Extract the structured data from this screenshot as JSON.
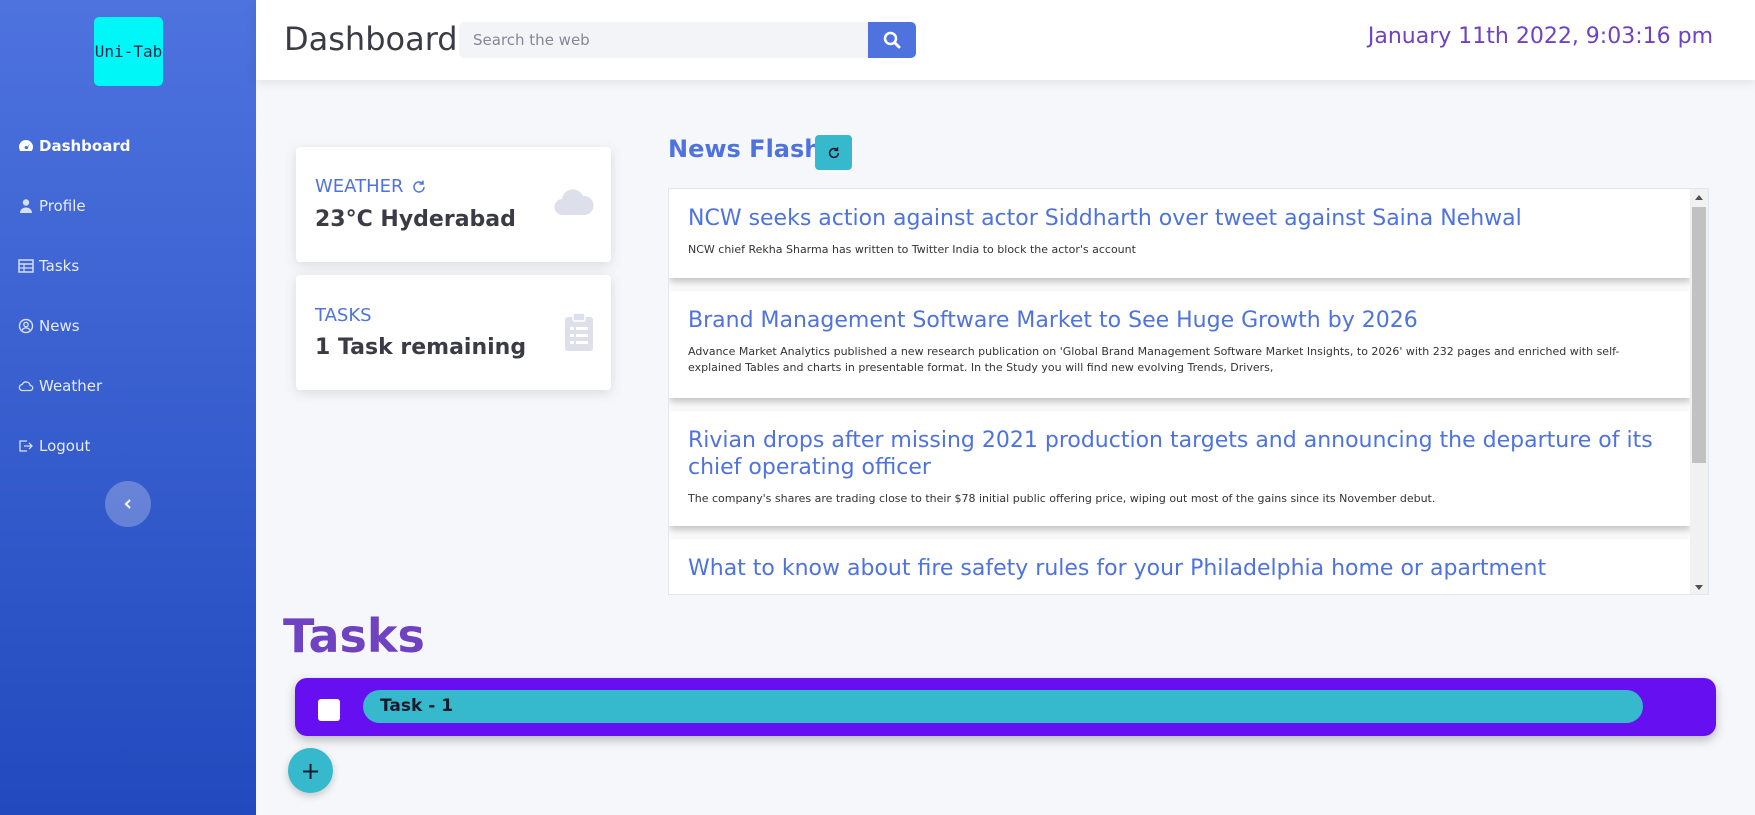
{
  "app": {
    "logo_text": "Uni-Tab"
  },
  "sidebar": {
    "items": [
      {
        "label": "Dashboard",
        "icon": "gauge-icon",
        "active": true
      },
      {
        "label": "Profile",
        "icon": "user-icon",
        "active": false
      },
      {
        "label": "Tasks",
        "icon": "table-icon",
        "active": false
      },
      {
        "label": "News",
        "icon": "user-circle-icon",
        "active": false
      },
      {
        "label": "Weather",
        "icon": "cloud-icon",
        "active": false
      },
      {
        "label": "Logout",
        "icon": "sign-out-icon",
        "active": false
      }
    ],
    "collapse_icon": "chevron-left-icon"
  },
  "header": {
    "title": "Dashboard",
    "search_placeholder": "Search the web",
    "datetime": "January 11th 2022, 9:03:16 pm"
  },
  "weather_card": {
    "label": "WEATHER",
    "value": "23°C Hyderabad"
  },
  "tasks_card": {
    "label": "TASKS",
    "value": "1 Task remaining"
  },
  "news": {
    "title": "News Flash",
    "items": [
      {
        "headline": "NCW seeks action against actor Siddharth over tweet against Saina Nehwal",
        "description": "NCW chief Rekha Sharma has written to Twitter India to block the actor's account"
      },
      {
        "headline": "Brand Management Software Market to See Huge Growth by 2026",
        "description": "Advance Market Analytics published a new research publication on 'Global Brand Management Software Market Insights, to 2026' with 232 pages and enriched with self-explained Tables and charts in presentable format. In the Study you will find new evolving Trends, Drivers,"
      },
      {
        "headline": "Rivian drops after missing 2021 production targets and announcing the departure of its chief operating officer",
        "description": "The company's shares are trading close to their $78 initial public offering price, wiping out most of the gains since its November debut."
      },
      {
        "headline": "What to know about fire safety rules for your Philadelphia home or apartment",
        "description": ""
      }
    ]
  },
  "tasks_section": {
    "heading": "Tasks",
    "tasks": [
      {
        "label": "Task - 1",
        "done": false
      }
    ],
    "add_label": "+"
  },
  "colors": {
    "primary": "#4e73df",
    "info": "#36b9cc",
    "purple": "#6f42c1",
    "indigo": "#6610f2",
    "logo_bg": "#00f7f7"
  }
}
